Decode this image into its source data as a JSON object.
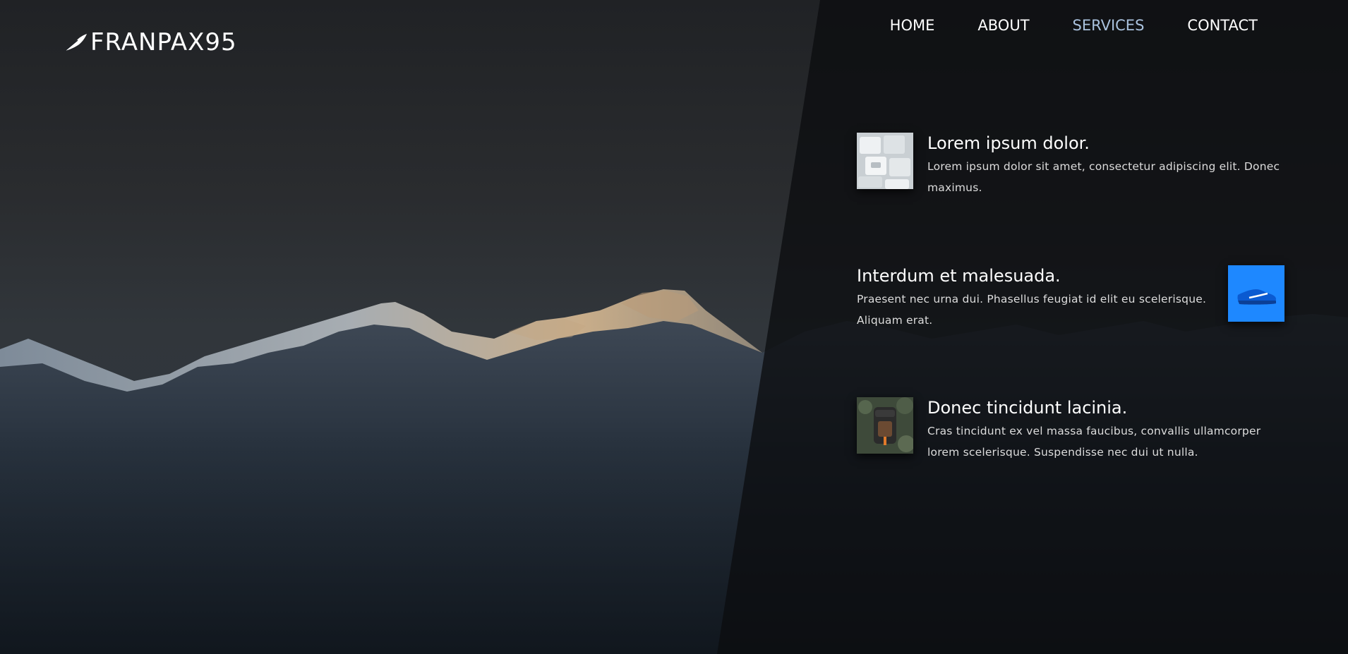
{
  "brand": {
    "name": "FRANPAX95",
    "icon": "feather-icon"
  },
  "nav": {
    "items": [
      {
        "label": "HOME",
        "active": false
      },
      {
        "label": "ABOUT",
        "active": false
      },
      {
        "label": "SERVICES",
        "active": true
      },
      {
        "label": "CONTACT",
        "active": false
      }
    ]
  },
  "services": [
    {
      "title": "Lorem ipsum dolor.",
      "body": "Lorem ipsum dolor sit amet, consectetur adipiscing elit. Donec maximus.",
      "thumb": "keyboard-thumbnail"
    },
    {
      "title": "Interdum et malesuada.",
      "body": "Praesent nec urna dui. Phasellus feugiat id elit eu scelerisque. Aliquam erat.",
      "thumb": "blue-sneaker-thumbnail"
    },
    {
      "title": "Donec tincidunt lacinia.",
      "body": "Cras tincidunt ex vel massa faucibus, convallis ullamcorper lorem scelerisque. Suspendisse nec dui ut nulla.",
      "thumb": "backpack-thumbnail"
    }
  ],
  "colors": {
    "nav_active": "#a9c1dd",
    "thumb_blue": "#1e88ff",
    "text": "#ffffff"
  }
}
